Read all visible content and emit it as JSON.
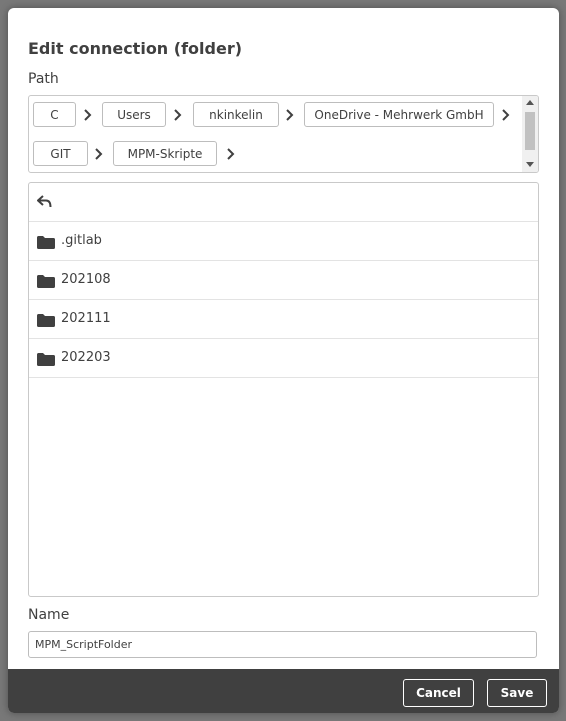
{
  "dialog": {
    "title": "Edit connection (folder)"
  },
  "path": {
    "label": "Path",
    "crumbs": [
      "C",
      "Users",
      "nkinkelin",
      "OneDrive - Mehrwerk GmbH",
      "GIT",
      "MPM-Skripte"
    ]
  },
  "file_list": {
    "back_icon": "back-arrow-icon",
    "items": [
      {
        "label": ".gitlab",
        "icon": "folder-icon"
      },
      {
        "label": "202108",
        "icon": "folder-icon"
      },
      {
        "label": "202111",
        "icon": "folder-icon"
      },
      {
        "label": "202203",
        "icon": "folder-icon"
      }
    ]
  },
  "name": {
    "label": "Name",
    "value": "MPM_ScriptFolder"
  },
  "footer": {
    "cancel_label": "Cancel",
    "save_label": "Save"
  },
  "colors": {
    "footer_bg": "#404040",
    "text": "#404040",
    "border": "#c9c9c9"
  }
}
